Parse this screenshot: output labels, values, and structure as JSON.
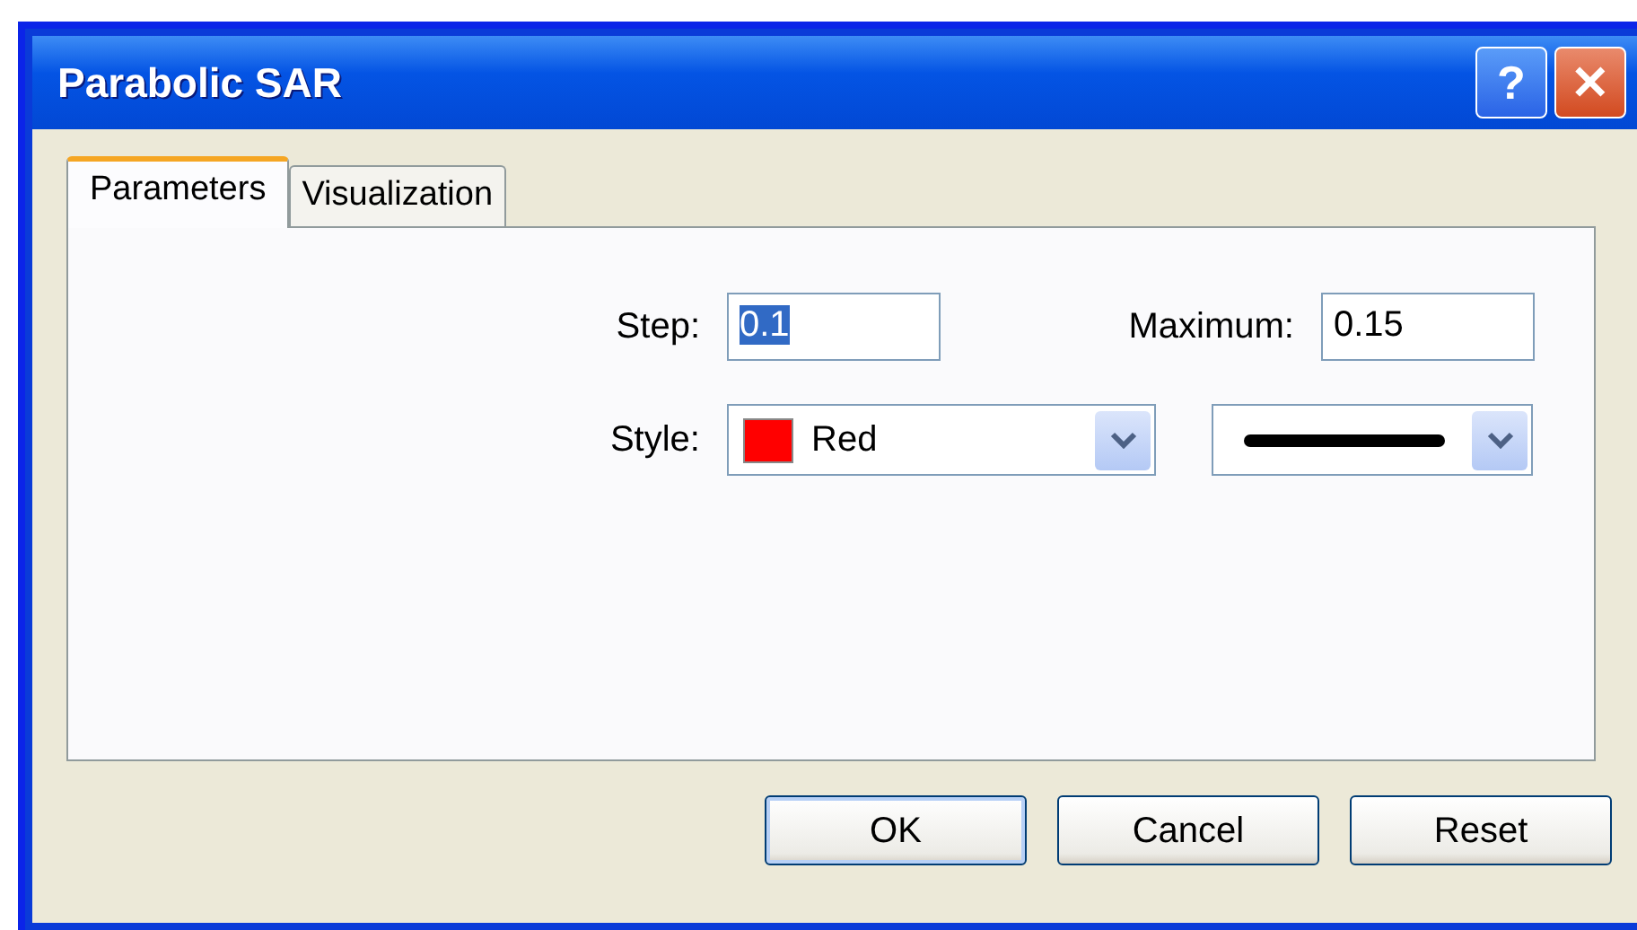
{
  "window": {
    "title": "Parabolic SAR",
    "title_buttons": [
      {
        "kind": "help",
        "label": "?"
      },
      {
        "kind": "close",
        "label": "✕"
      }
    ]
  },
  "tabs": [
    {
      "label": "Parameters",
      "selected": true
    },
    {
      "label": "Visualization",
      "selected": false
    }
  ],
  "fields": {
    "step": {
      "label": "Step:",
      "value": "0.1",
      "text_selected": true
    },
    "maximum": {
      "label": "Maximum:",
      "value": "0.15",
      "text_selected": false
    }
  },
  "style": {
    "label": "Style:",
    "color": {
      "value": "Red",
      "color": "#ff0000"
    },
    "line": {
      "kind": "solid"
    }
  },
  "buttons": [
    {
      "label": "OK",
      "default": true
    },
    {
      "label": "Cancel",
      "default": false
    },
    {
      "label": "Reset",
      "default": false
    }
  ]
}
